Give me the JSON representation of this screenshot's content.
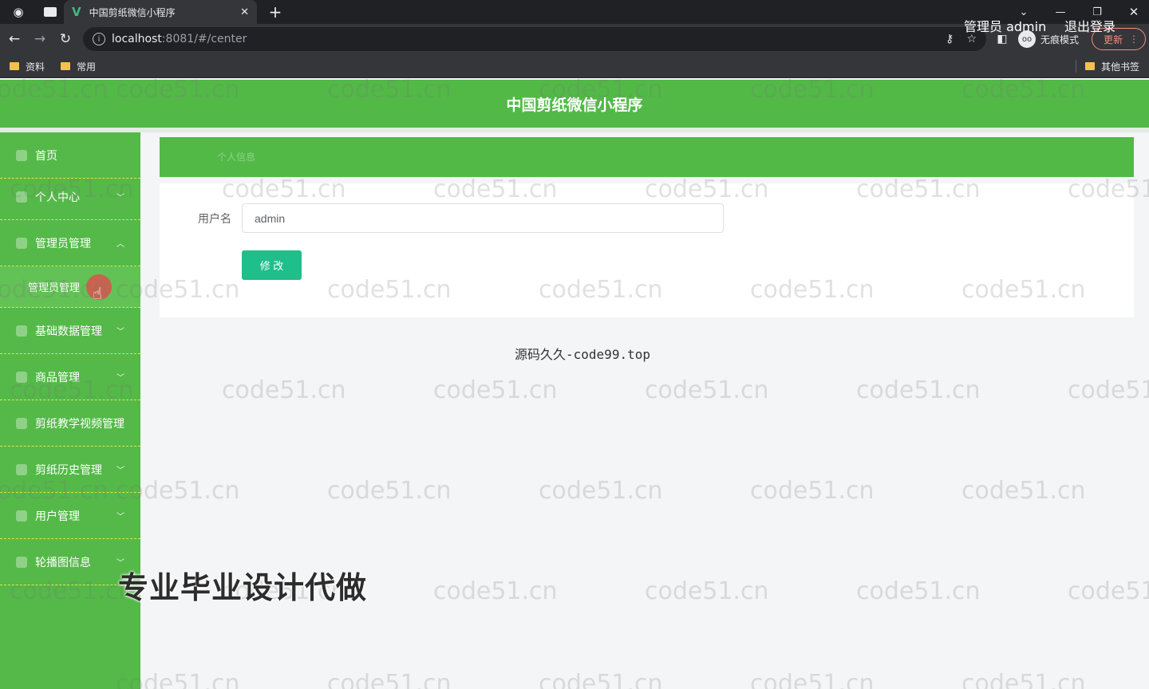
{
  "browser": {
    "tab_title": "中国剪纸微信小程序",
    "url_host": "localhost",
    "url_path": ":8081/#/center",
    "incognito_label": "无痕模式",
    "update_label": "更新",
    "bookmarks": [
      "资料",
      "常用"
    ],
    "other_bookmarks": "其他书签"
  },
  "header": {
    "title": "中国剪纸微信小程序",
    "user": "管理员 admin",
    "logout": "退出登录"
  },
  "sidebar": {
    "items": [
      {
        "label": "首页"
      },
      {
        "label": "个人中心"
      },
      {
        "label": "管理员管理"
      },
      {
        "label": "基础数据管理"
      },
      {
        "label": "商品管理"
      },
      {
        "label": "剪纸教学视频管理"
      },
      {
        "label": "剪纸历史管理"
      },
      {
        "label": "用户管理"
      },
      {
        "label": "轮播图信息"
      }
    ],
    "submenu_label": "管理员管理"
  },
  "main": {
    "breadcrumb": "个人信息",
    "username_label": "用户名",
    "username_value": "admin",
    "submit_label": "修 改"
  },
  "footer_note": "源码久久-code99.top",
  "promo": "专业毕业设计代做",
  "watermark": "code51.cn",
  "colors": {
    "header_green": "#52b947",
    "sidebar_green": "#54b948",
    "button_teal": "#1fbe8a"
  }
}
